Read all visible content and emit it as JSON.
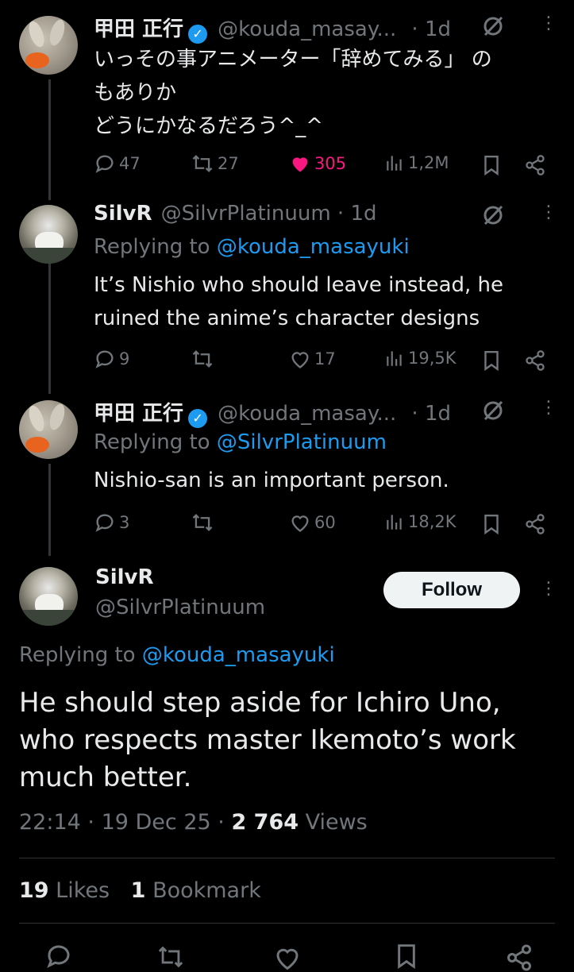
{
  "tweets": [
    {
      "name": "甲田 正行",
      "handle": "@kouda_masay...",
      "time": "· 1d",
      "lines": [
        "いっその事アニメーター「辞めてみる」 の",
        "もありか",
        "どうにかなるだろう^_^"
      ],
      "replies": "47",
      "retweets": "27",
      "likes": "305",
      "views": "1,2M"
    },
    {
      "name": "SilvR",
      "handle": "@SilvrPlatinuum · 1d",
      "replying_prefix": "Replying to ",
      "replying_to": "@kouda_masayuki",
      "lines": [
        "It’s Nishio who should leave instead, he",
        "ruined the anime’s character designs"
      ],
      "replies": "9",
      "retweets": "",
      "likes": "17",
      "views": "19,5K"
    },
    {
      "name": "甲田 正行",
      "handle": "@kouda_masay...",
      "time": "· 1d",
      "replying_prefix": "Replying to ",
      "replying_to": "@SilvrPlatinuum",
      "lines": [
        "Nishio-san is an important person."
      ],
      "replies": "3",
      "retweets": "",
      "likes": "60",
      "views": "18,2K"
    }
  ],
  "main_tweet": {
    "name": "SilvR",
    "handle": "@SilvrPlatinuum",
    "follow_label": "Follow",
    "replying_prefix": "Replying to ",
    "replying_to": "@kouda_masayuki",
    "lines": [
      "He should step aside for Ichiro Uno,",
      "who respects master Ikemoto’s work",
      "much better."
    ],
    "time": "22:14",
    "date": "19 Dec 25",
    "views_count": "2 764",
    "views_label": "Views",
    "likes_count": "19",
    "likes_label": "Likes",
    "bookmarks_count": "1",
    "bookmarks_label": "Bookmark"
  },
  "colors": {
    "background": "#000000",
    "text": "#e7e9ea",
    "secondary": "#71767b",
    "link": "#1d9bf0",
    "like": "#f91880",
    "verified": "#1d9bf0"
  },
  "icons": [
    "verified-icon",
    "grok-icon",
    "more-icon",
    "reply-icon",
    "retweet-icon",
    "like-icon",
    "views-icon",
    "bookmark-icon",
    "share-icon"
  ]
}
